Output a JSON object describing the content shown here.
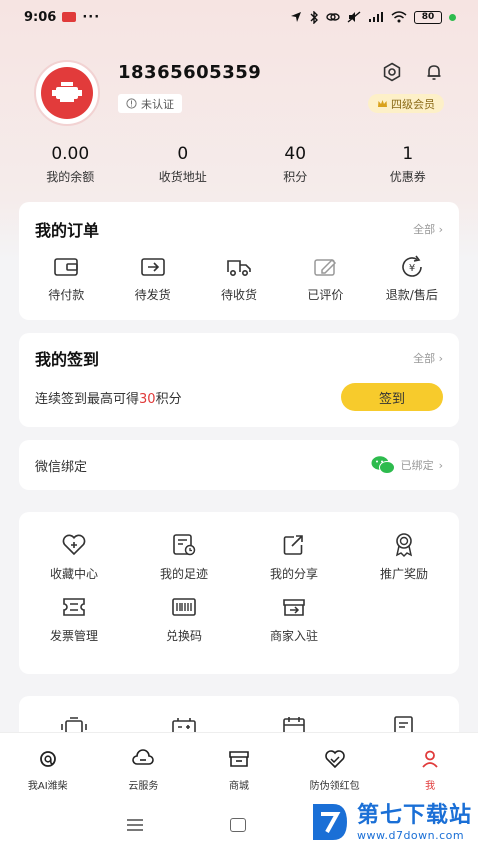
{
  "status_bar": {
    "time": "9:06",
    "dots": "···",
    "battery": "80"
  },
  "profile": {
    "phone": "18365605359",
    "cert_status": "未认证",
    "vip_level": "四级会员"
  },
  "stats": [
    {
      "value": "0.00",
      "label": "我的余额"
    },
    {
      "value": "0",
      "label": "收货地址"
    },
    {
      "value": "40",
      "label": "积分"
    },
    {
      "value": "1",
      "label": "优惠券"
    }
  ],
  "orders": {
    "title": "我的订单",
    "more": "全部",
    "items": [
      {
        "label": "待付款",
        "icon": "wallet-icon"
      },
      {
        "label": "待发货",
        "icon": "ship-icon"
      },
      {
        "label": "待收货",
        "icon": "truck-icon"
      },
      {
        "label": "已评价",
        "icon": "edit-icon"
      },
      {
        "label": "退款/售后",
        "icon": "refund-icon"
      }
    ]
  },
  "signin": {
    "title": "我的签到",
    "more": "全部",
    "text_prefix": "连续签到最高可得",
    "points": "30",
    "text_suffix": "积分",
    "button": "签到"
  },
  "wechat": {
    "label": "微信绑定",
    "status": "已绑定"
  },
  "tools": [
    {
      "label": "收藏中心",
      "icon": "heart-icon"
    },
    {
      "label": "我的足迹",
      "icon": "footprint-icon"
    },
    {
      "label": "我的分享",
      "icon": "share-icon"
    },
    {
      "label": "推广奖励",
      "icon": "award-icon"
    },
    {
      "label": "发票管理",
      "icon": "invoice-icon"
    },
    {
      "label": "兑换码",
      "icon": "barcode-icon"
    },
    {
      "label": "商家入驻",
      "icon": "merchant-icon"
    }
  ],
  "tabbar": [
    {
      "label": "我AI潍柴",
      "icon": "ai-icon"
    },
    {
      "label": "云服务",
      "icon": "cloud-service-icon"
    },
    {
      "label": "商城",
      "icon": "shop-icon"
    },
    {
      "label": "防伪领红包",
      "icon": "anti-fake-icon"
    },
    {
      "label": "我",
      "icon": "user-icon",
      "active": true
    }
  ],
  "watermark": {
    "title": "第七下载站",
    "url": "www.d7down.com"
  },
  "colors": {
    "accent": "#e03a3a",
    "sign_button": "#f7cb2c",
    "vip_bg": "#fdf0c8",
    "watermark": "#1a6fd6"
  }
}
